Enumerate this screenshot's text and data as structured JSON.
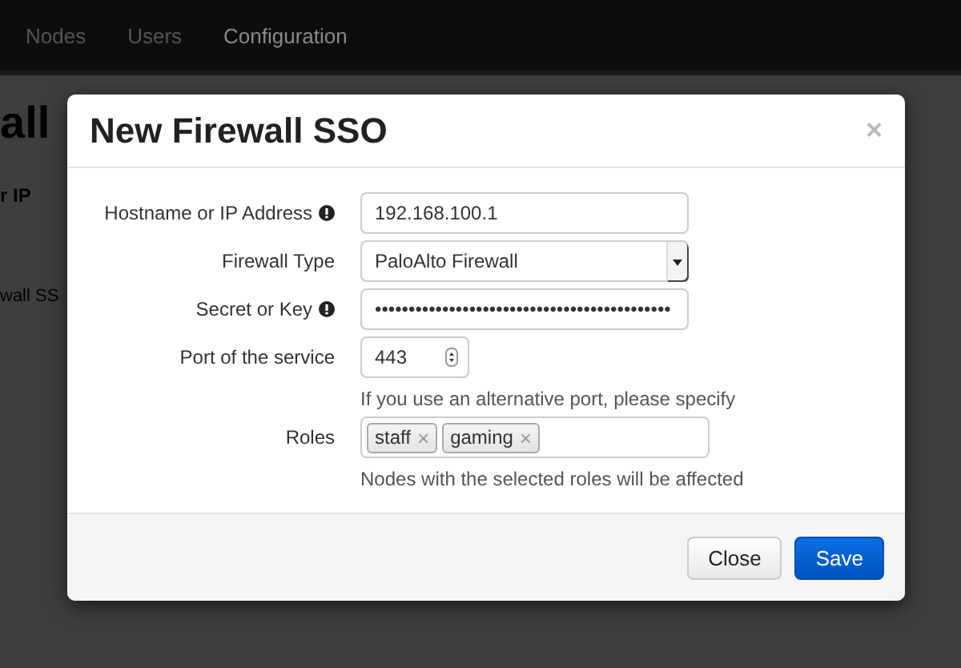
{
  "navbar": {
    "items": [
      {
        "label": "Nodes",
        "selected": false
      },
      {
        "label": "Users",
        "selected": false
      },
      {
        "label": "Configuration",
        "selected": true
      }
    ]
  },
  "page": {
    "title": "all",
    "column_label": "r IP",
    "row_text": "wall SS"
  },
  "modal": {
    "title": "New Firewall SSO",
    "close": "×",
    "fields": [
      {
        "kind": "text",
        "label": "Hostname or IP Address",
        "info": true,
        "value": "192.168.100.1"
      },
      {
        "kind": "select",
        "label": "Firewall Type",
        "info": false,
        "value": "PaloAlto Firewall"
      },
      {
        "kind": "text",
        "label": "Secret or Key",
        "info": true,
        "value": "••••••••••••••••••••••••••••••••••••••••••••"
      },
      {
        "kind": "number",
        "label": "Port of the service",
        "info": false,
        "value": "443",
        "help": "If you use an alternative port, please specify"
      },
      {
        "kind": "tags",
        "label": "Roles",
        "info": false,
        "tags": [
          {
            "label": "staff",
            "remove": "×"
          },
          {
            "label": "gaming",
            "remove": "×"
          }
        ],
        "help": "Nodes with the selected roles will be affected"
      }
    ],
    "buttons": [
      {
        "kind": "default",
        "label": "Close"
      },
      {
        "kind": "primary",
        "label": "Save"
      }
    ]
  }
}
